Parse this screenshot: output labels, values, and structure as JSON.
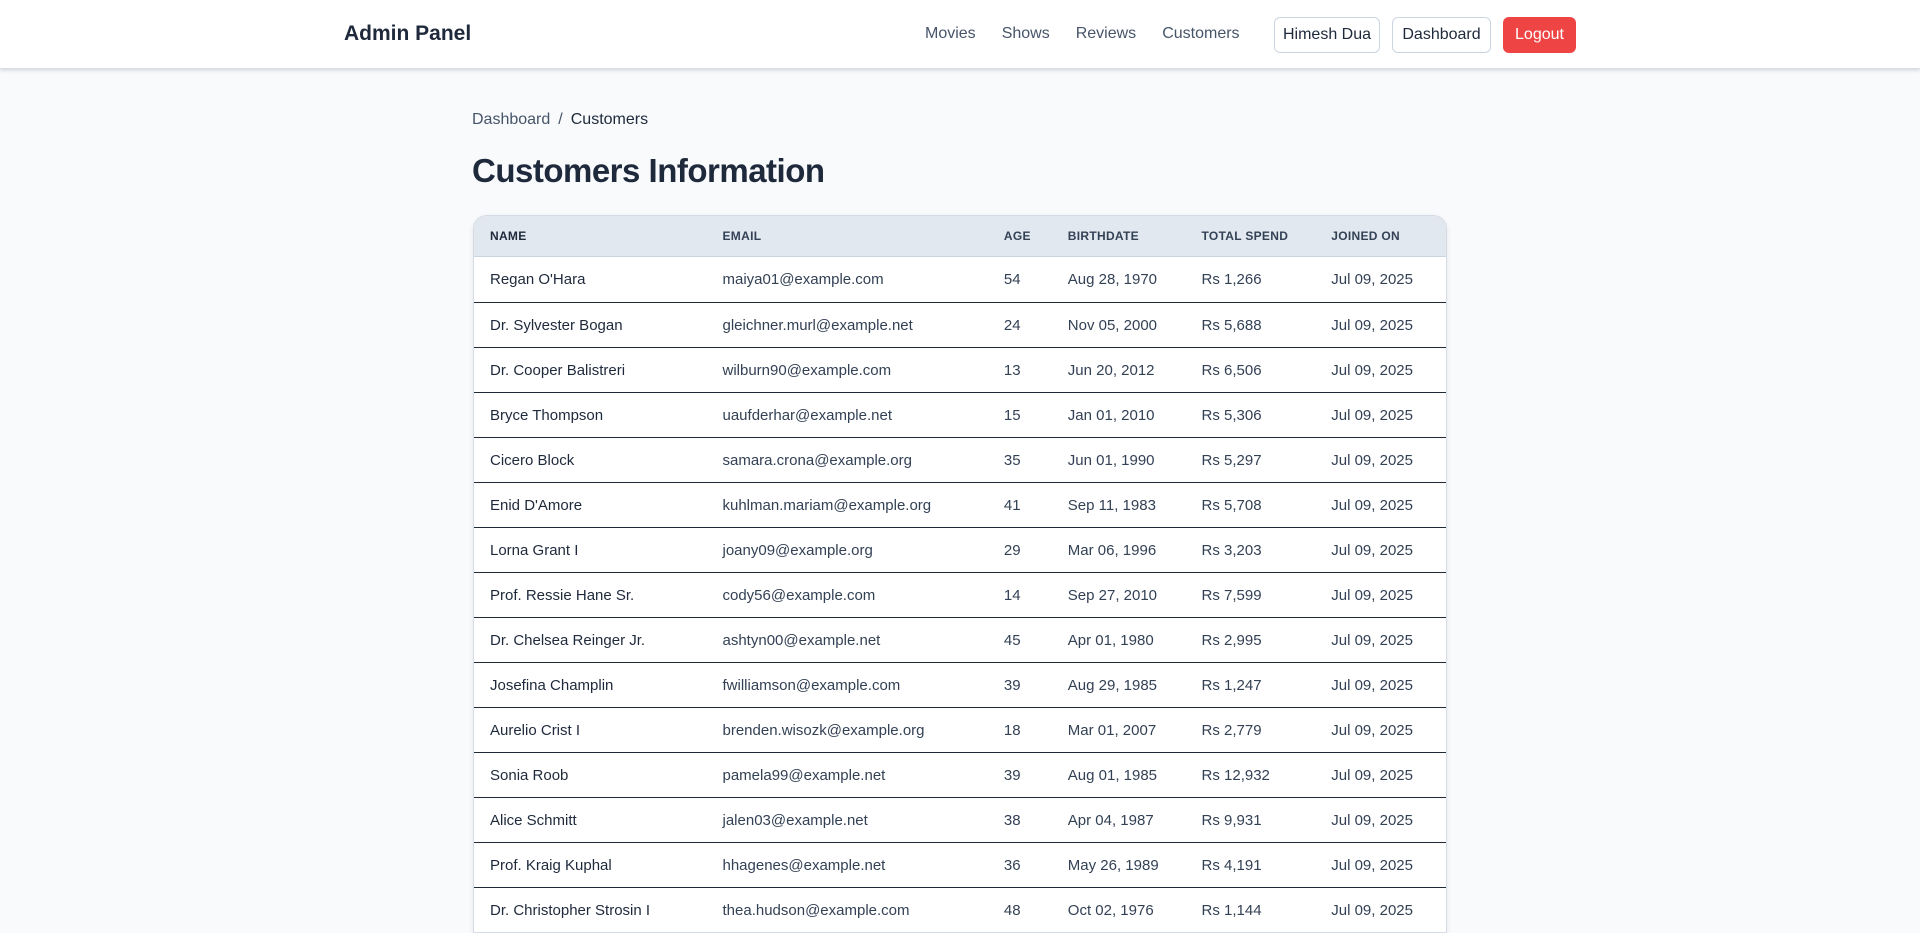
{
  "nav": {
    "brand": "Admin Panel",
    "links": [
      "Movies",
      "Shows",
      "Reviews",
      "Customers"
    ],
    "user_button": "Himesh Dua",
    "dashboard_button": "Dashboard",
    "logout_button": "Logout"
  },
  "breadcrumb": {
    "parent": "Dashboard",
    "separator": "/",
    "current": "Customers"
  },
  "page_title": "Customers Information",
  "colors": {
    "logout": "#ef4444",
    "header_bg": "#e2e8f0",
    "page_bg": "#f8fafc"
  },
  "table": {
    "columns": [
      "NAME",
      "EMAIL",
      "AGE",
      "BIRTHDATE",
      "TOTAL SPEND",
      "JOINED ON"
    ],
    "rows": [
      [
        "Regan O'Hara",
        "maiya01@example.com",
        "54",
        "Aug 28, 1970",
        "Rs 1,266",
        "Jul 09, 2025"
      ],
      [
        "Dr. Sylvester Bogan",
        "gleichner.murl@example.net",
        "24",
        "Nov 05, 2000",
        "Rs 5,688",
        "Jul 09, 2025"
      ],
      [
        "Dr. Cooper Balistreri",
        "wilburn90@example.com",
        "13",
        "Jun 20, 2012",
        "Rs 6,506",
        "Jul 09, 2025"
      ],
      [
        "Bryce Thompson",
        "uaufderhar@example.net",
        "15",
        "Jan 01, 2010",
        "Rs 5,306",
        "Jul 09, 2025"
      ],
      [
        "Cicero Block",
        "samara.crona@example.org",
        "35",
        "Jun 01, 1990",
        "Rs 5,297",
        "Jul 09, 2025"
      ],
      [
        "Enid D'Amore",
        "kuhlman.mariam@example.org",
        "41",
        "Sep 11, 1983",
        "Rs 5,708",
        "Jul 09, 2025"
      ],
      [
        "Lorna Grant I",
        "joany09@example.org",
        "29",
        "Mar 06, 1996",
        "Rs 3,203",
        "Jul 09, 2025"
      ],
      [
        "Prof. Ressie Hane Sr.",
        "cody56@example.com",
        "14",
        "Sep 27, 2010",
        "Rs 7,599",
        "Jul 09, 2025"
      ],
      [
        "Dr. Chelsea Reinger Jr.",
        "ashtyn00@example.net",
        "45",
        "Apr 01, 1980",
        "Rs 2,995",
        "Jul 09, 2025"
      ],
      [
        "Josefina Champlin",
        "fwilliamson@example.com",
        "39",
        "Aug 29, 1985",
        "Rs 1,247",
        "Jul 09, 2025"
      ],
      [
        "Aurelio Crist I",
        "brenden.wisozk@example.org",
        "18",
        "Mar 01, 2007",
        "Rs 2,779",
        "Jul 09, 2025"
      ],
      [
        "Sonia Roob",
        "pamela99@example.net",
        "39",
        "Aug 01, 1985",
        "Rs 12,932",
        "Jul 09, 2025"
      ],
      [
        "Alice Schmitt",
        "jalen03@example.net",
        "38",
        "Apr 04, 1987",
        "Rs 9,931",
        "Jul 09, 2025"
      ],
      [
        "Prof. Kraig Kuphal",
        "hhagenes@example.net",
        "36",
        "May 26, 1989",
        "Rs 4,191",
        "Jul 09, 2025"
      ],
      [
        "Dr. Christopher Strosin I",
        "thea.hudson@example.com",
        "48",
        "Oct 02, 1976",
        "Rs 1,144",
        "Jul 09, 2025"
      ]
    ]
  }
}
